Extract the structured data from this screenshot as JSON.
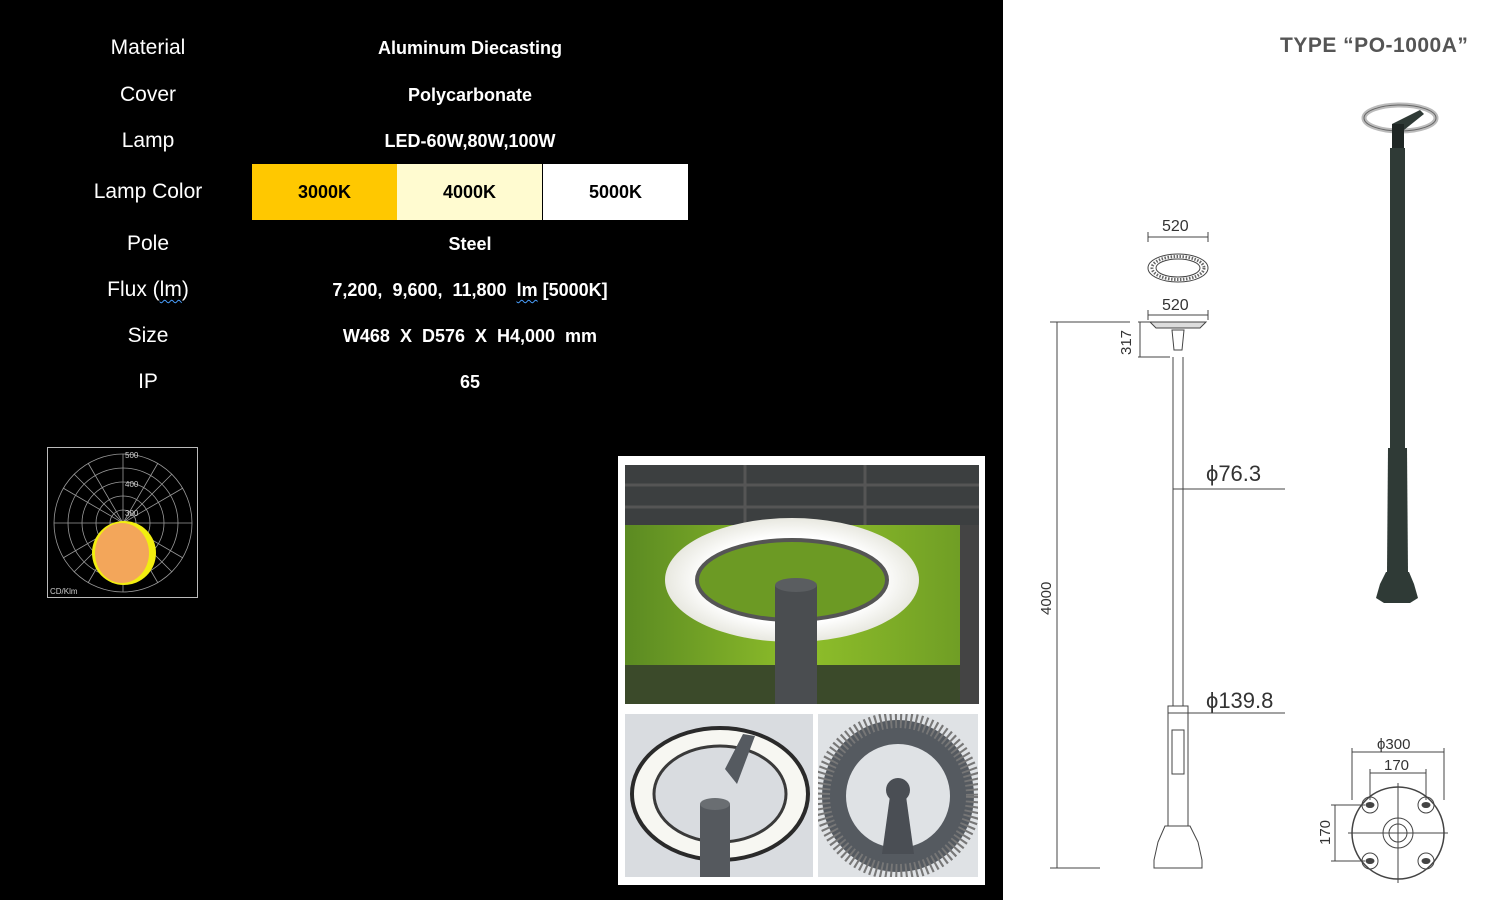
{
  "specs": [
    {
      "label": "Material",
      "value": "Aluminum Diecasting"
    },
    {
      "label": "Cover",
      "value": "Polycarbonate"
    },
    {
      "label": "Lamp",
      "value": "LED-60W,80W,100W"
    },
    {
      "label": "Lamp Color",
      "value": ""
    },
    {
      "label": "Pole",
      "value": "Steel"
    },
    {
      "label": "Flux (lm)",
      "value": "7,200,  9,600,  11,800  lm  [5000K]"
    },
    {
      "label": "Size",
      "value": "W468  X  D576  X  H4,000  mm"
    },
    {
      "label": "IP",
      "value": "65"
    }
  ],
  "flux": {
    "label_prefix": "Flux (",
    "label_unit": "lm",
    "label_suffix": ")",
    "value_prefix": "7,200,  9,600,  11,800  ",
    "value_unit": "lm",
    "value_suffix": " [5000K]"
  },
  "lamp_colors": [
    {
      "label": "3000K",
      "color": "#ffc800"
    },
    {
      "label": "4000K",
      "color": "#fffbd0"
    },
    {
      "label": "5000K",
      "color": "#ffffff"
    }
  ],
  "polar": {
    "ticks": [
      "500",
      "400",
      "300"
    ],
    "unit": "CD/Klm",
    "fill_color": "#f3a65a",
    "edge_color": "#f2ee10"
  },
  "type_title": "TYPE “PO-1000A”",
  "drawing": {
    "top_width": "520",
    "head_width": "520",
    "head_height": "317",
    "pole_diameter": "ϕ76.3",
    "base_diameter": "ϕ139.8",
    "total_height": "4000",
    "base_plate_diameter": "ϕ300",
    "bolt_spacing_x": "170",
    "bolt_spacing_y": "170"
  },
  "colors": {
    "pole": "#2f3a36",
    "background_left": "#000000",
    "background_right": "#ffffff"
  }
}
